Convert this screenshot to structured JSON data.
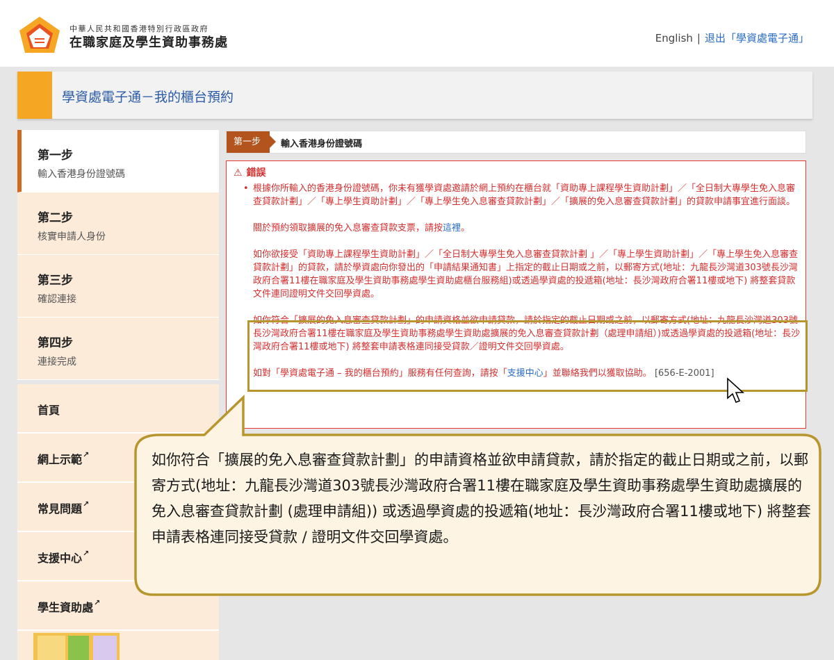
{
  "header": {
    "org_sub": "中華人民共和國香港特別行政區政府",
    "org_main": "在職家庭及學生資助事務處",
    "english": "English",
    "separator": "|",
    "logout": "退出「學資處電子通」"
  },
  "page_title": "學資處電子通－我的櫃台預約",
  "steps": [
    {
      "title": "第一步",
      "sub": "輸入香港身份證號碼"
    },
    {
      "title": "第二步",
      "sub": "核實申請人身份"
    },
    {
      "title": "第三步",
      "sub": "確認連接"
    },
    {
      "title": "第四步",
      "sub": "連接完成"
    }
  ],
  "menu": [
    {
      "label": "首頁"
    },
    {
      "label": "網上示範"
    },
    {
      "label": "常見問題"
    },
    {
      "label": "支援中心"
    },
    {
      "label": "學生資助處"
    }
  ],
  "crumb": {
    "tag": "第一步",
    "text": "輸入香港身份證號碼"
  },
  "error": {
    "heading": "錯誤",
    "p1": "根據你所輸入的香港身份證號碼，你未有獲學資處邀請於網上預約在櫃台就「資助專上課程學生資助計劃」／「全日制大專學生免入息審查貸款計劃」／「專上學生資助計劃」／「專上學生免入息審查貸款計劃」／「擴展的免入息審查貸款計劃」的貸款申請事宜進行面談。",
    "p2_before": "關於預約領取擴展的免入息審查貸款支票，請按",
    "p2_link": "這裡",
    "p2_after": "。",
    "p3": "如你欲接受「資助專上課程學生資助計劃」／「全日制大專學生免入息審查貸款計劃 」／「專上學生資助計劃」／「專上學生免入息審查貸款計劃」的貸款，請於學資處向你發出的「申請結果通知書」上指定的截止日期或之前，以郵寄方式(地址：九龍長沙灣道303號長沙灣政府合署11樓在職家庭及學生資助事務處學生資助處櫃台服務組)或透過學資處的投遞箱(地址：長沙灣政府合署11樓或地下) 將整套貸款文件連同證明文件交回學資處。",
    "p4": "如你符合「擴展的免入息審查貸款計劃」的申請資格並欲申請貸款，請於指定的截止日期或之前，以郵寄方式(地址：九龍長沙灣道303號長沙灣政府合署11樓在職家庭及學生資助事務處學生資助處擴展的免入息審查貸款計劃（處理申請組）)或透過學資處的投遞箱(地址：長沙灣政府合署11樓或地下) 將整套申請表格連同接受貸款／證明文件交回學資處。",
    "p5_before": "如對「學資處電子通 – 我的櫃台預約」服務有任何查詢，請按「",
    "p5_link": "支援中心",
    "p5_after": "」並聯絡我們以獲取協助。",
    "code": "[656-E-2001]"
  },
  "callout": {
    "text": "如你符合「擴展的免入息審查貸款計劃」的申請資格並欲申請貸款，請於指定的截止日期或之前，以郵寄方式(地址：九龍長沙灣道303號長沙灣政府合署11樓在職家庭及學生資助事務處學生資助處擴展的免入息審查貸款計劃 (處理申請組)) 或透過學資處的投遞箱(地址：長沙灣政府合署11樓或地下) 將整套申請表格連同接受貸款 / 證明文件交回學資處。"
  },
  "colors": {
    "accent": "#f5a623",
    "error": "#d32f2f",
    "link": "#2a6cc4",
    "callout_border": "#b8962e"
  }
}
